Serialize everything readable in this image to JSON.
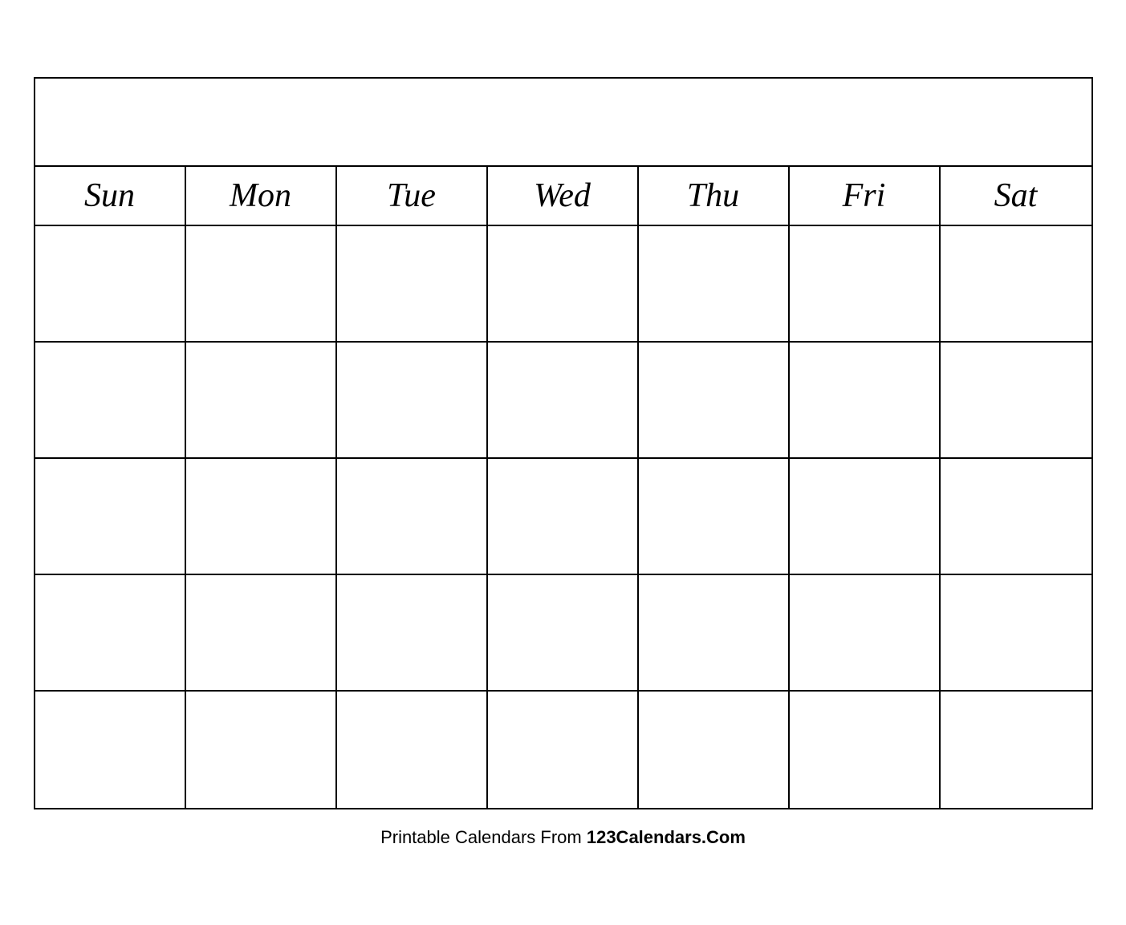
{
  "calendar": {
    "title": "",
    "days": [
      "Sun",
      "Mon",
      "Tue",
      "Wed",
      "Thu",
      "Fri",
      "Sat"
    ],
    "rows": 5,
    "cols": 7
  },
  "footer": {
    "text_normal": "Printable Calendars From ",
    "text_bold": "123Calendars.Com"
  }
}
